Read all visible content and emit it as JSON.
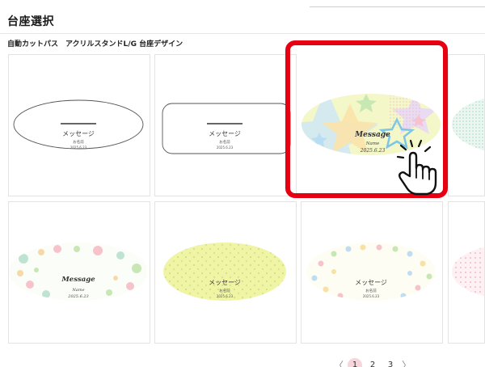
{
  "header": {
    "title": "台座選択"
  },
  "section": {
    "label": "自動カットパス　アクリルスタンドL/G 台座デザイン"
  },
  "cards": [
    {
      "id": "plain-oval",
      "message": "メッセージ",
      "name": "お名前",
      "date": "2025.6.23"
    },
    {
      "id": "plain-rect",
      "message": "メッセージ",
      "name": "お名前",
      "date": "2025.6.23"
    },
    {
      "id": "star-oval",
      "message": "Message",
      "name": "Name",
      "date": "2025.6.23"
    },
    {
      "id": "flower-oval",
      "message": "Message",
      "name": "Name",
      "date": "2025.6.23"
    },
    {
      "id": "yellow-oval",
      "message": "メッセージ",
      "name": "お名前",
      "date": "2025.6.23"
    },
    {
      "id": "dots-oval",
      "message": "メッセージ",
      "name": "お名前",
      "date": "2025.6.23"
    }
  ],
  "selection": {
    "card": "star-oval",
    "highlight_color": "#e60012"
  },
  "icons": {
    "pointer": "pointing-hand-icon",
    "prev": "chevron-left-icon",
    "next": "chevron-right-icon"
  },
  "pagination": {
    "prev": "〈",
    "pages": [
      "1",
      "2",
      "3"
    ],
    "current": "1",
    "next": "〉"
  },
  "colors": {
    "accent": "#e60012",
    "page_active": "#f5d6dc"
  }
}
